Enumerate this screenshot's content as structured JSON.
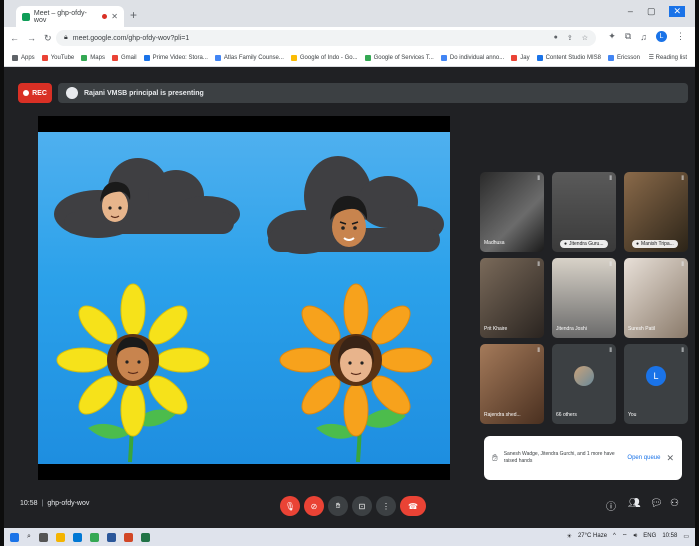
{
  "browser": {
    "tab_title": "Meet – ghp-ofdy-wov",
    "url": "meet.google.com/ghp-ofdy-wov?pli=1",
    "bookmarks": [
      {
        "label": "Apps",
        "color": "#5f6368"
      },
      {
        "label": "YouTube",
        "color": "#ea4335"
      },
      {
        "label": "Maps",
        "color": "#34a853"
      },
      {
        "label": "Gmail",
        "color": "#ea4335"
      },
      {
        "label": "Prime Video: Stora...",
        "color": "#1a73e8"
      },
      {
        "label": "Atlas Family Counse...",
        "color": "#4285f4"
      },
      {
        "label": "Google of Indo - Go...",
        "color": "#fbbc04"
      },
      {
        "label": "Google of Services T...",
        "color": "#34a853"
      },
      {
        "label": "Do individual anno...",
        "color": "#4285f4"
      },
      {
        "label": "Jay",
        "color": "#ea4335"
      },
      {
        "label": "Content Studio MIS8",
        "color": "#1a73e8"
      },
      {
        "label": "Ericsson",
        "color": "#4285f4"
      }
    ],
    "reading_list": "Reading list",
    "profile_initial": "L"
  },
  "meet": {
    "rec_label": "REC",
    "presenter_banner": "Rajani VMSB principal is presenting",
    "time": "10:58",
    "meeting_code": "ghp-ofdy-wov",
    "tiles": [
      {
        "name": "Madhusa",
        "style": "dark"
      },
      {
        "name": "Jitendra Guru...",
        "style": "badge"
      },
      {
        "name": "Manish Tripa...",
        "style": "badge-warm"
      },
      {
        "name": "Prit Khaire",
        "style": "dark2"
      },
      {
        "name": "Jitendra Joshi",
        "style": "room"
      },
      {
        "name": "Suresh Patil",
        "style": "light"
      },
      {
        "name": "Rajendra shed...",
        "style": "warm"
      },
      {
        "name": "66 others",
        "style": "others"
      },
      {
        "name": "You",
        "style": "you"
      }
    ],
    "you_initial": "L",
    "raised_hands_text": "Sanesh Wadge, Jitendra Gurchi, and 1 more have raised hands",
    "open_queue": "Open queue"
  },
  "taskbar": {
    "weather": "27°C Haze",
    "language": "ENG",
    "clock": "10:58"
  },
  "colors": {
    "accent": "#1a73e8",
    "danger": "#ea4335",
    "meet_bg": "#202124",
    "tile_bg": "#3c4043"
  }
}
